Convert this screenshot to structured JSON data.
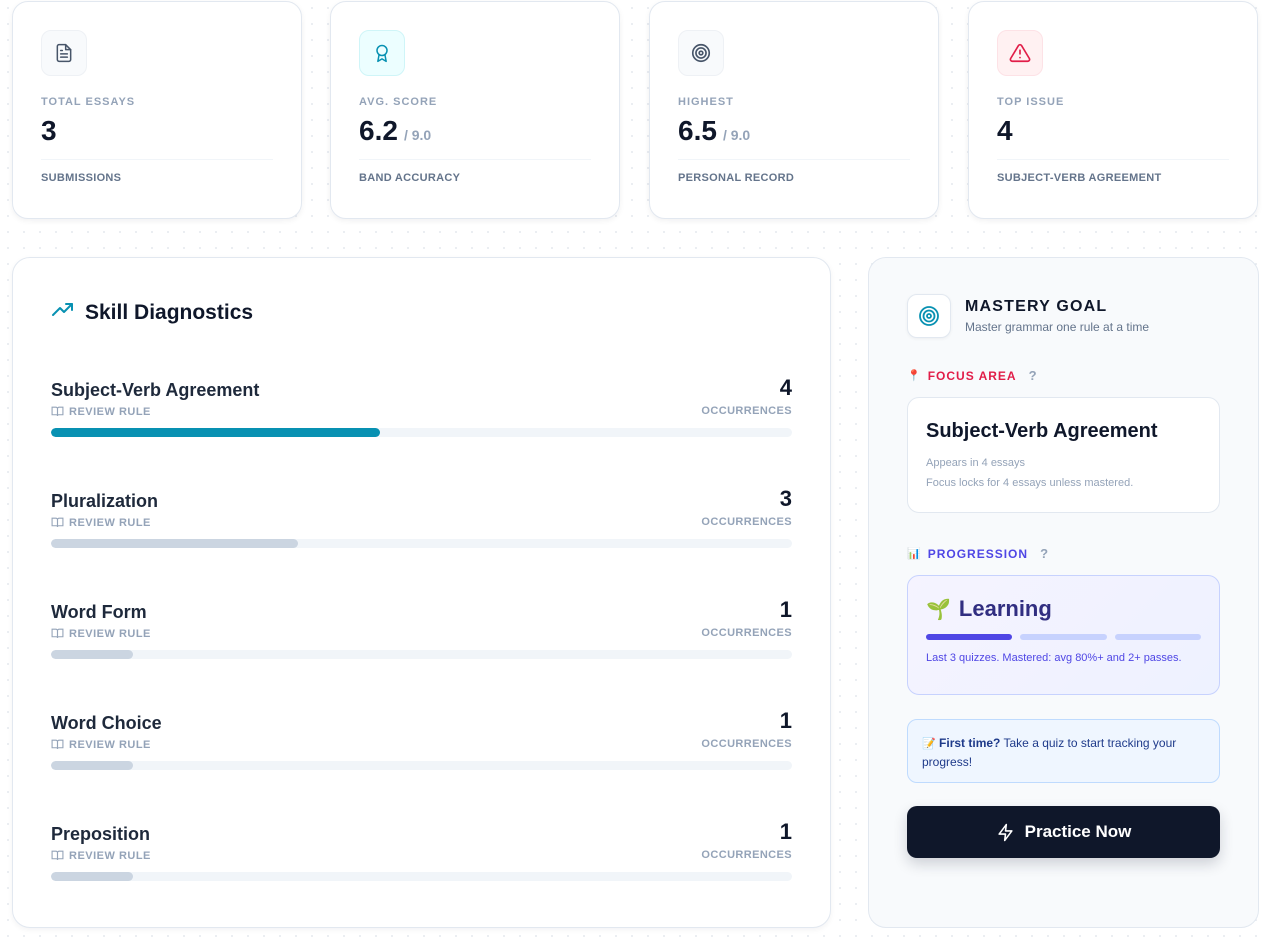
{
  "stats": [
    {
      "label": "TOTAL ESSAYS",
      "value": "3",
      "suffix": "",
      "foot": "SUBMISSIONS",
      "icon": "document-icon"
    },
    {
      "label": "AVG. SCORE",
      "value": "6.2",
      "suffix": "/ 9.0",
      "foot": "BAND ACCURACY",
      "icon": "award-icon"
    },
    {
      "label": "HIGHEST",
      "value": "6.5",
      "suffix": "/ 9.0",
      "foot": "PERSONAL RECORD",
      "icon": "target-icon"
    },
    {
      "label": "TOP ISSUE",
      "value": "4",
      "suffix": "",
      "foot": "SUBJECT-VERB AGREEMENT",
      "icon": "warning-icon"
    }
  ],
  "diagnostics": {
    "title": "Skill Diagnostics",
    "review_label": "REVIEW RULE",
    "occurrences_label": "OCCURRENCES",
    "skills": [
      {
        "name": "Subject-Verb Agreement",
        "count": "4",
        "fill_fraction": 0.444
      },
      {
        "name": "Pluralization",
        "count": "3",
        "fill_fraction": 0.333
      },
      {
        "name": "Word Form",
        "count": "1",
        "fill_fraction": 0.111
      },
      {
        "name": "Word Choice",
        "count": "1",
        "fill_fraction": 0.111
      },
      {
        "name": "Preposition",
        "count": "1",
        "fill_fraction": 0.111
      }
    ]
  },
  "mastery": {
    "title": "MASTERY GOAL",
    "subtitle": "Master grammar one rule at a time",
    "focus_label": "FOCUS AREA",
    "focus_name": "Subject-Verb Agreement",
    "focus_meta": "Appears in 4 essays",
    "focus_meta2": "Focus locks for 4 essays unless mastered.",
    "progression_label": "PROGRESSION",
    "level": "Learning",
    "progress_segments": [
      true,
      false,
      false
    ],
    "progress_note": "Last 3 quizzes. Mastered: avg 80%+ and 2+ passes.",
    "tip_bold": "First time?",
    "tip_text": " Take a quiz to start tracking your progress!",
    "practice_label": "Practice Now",
    "help_symbol": "?"
  },
  "colors": {
    "accent_teal": "#0891b2",
    "focus_red": "#e11d48",
    "progress_indigo": "#4f46e5",
    "button_dark": "#0f172a"
  }
}
